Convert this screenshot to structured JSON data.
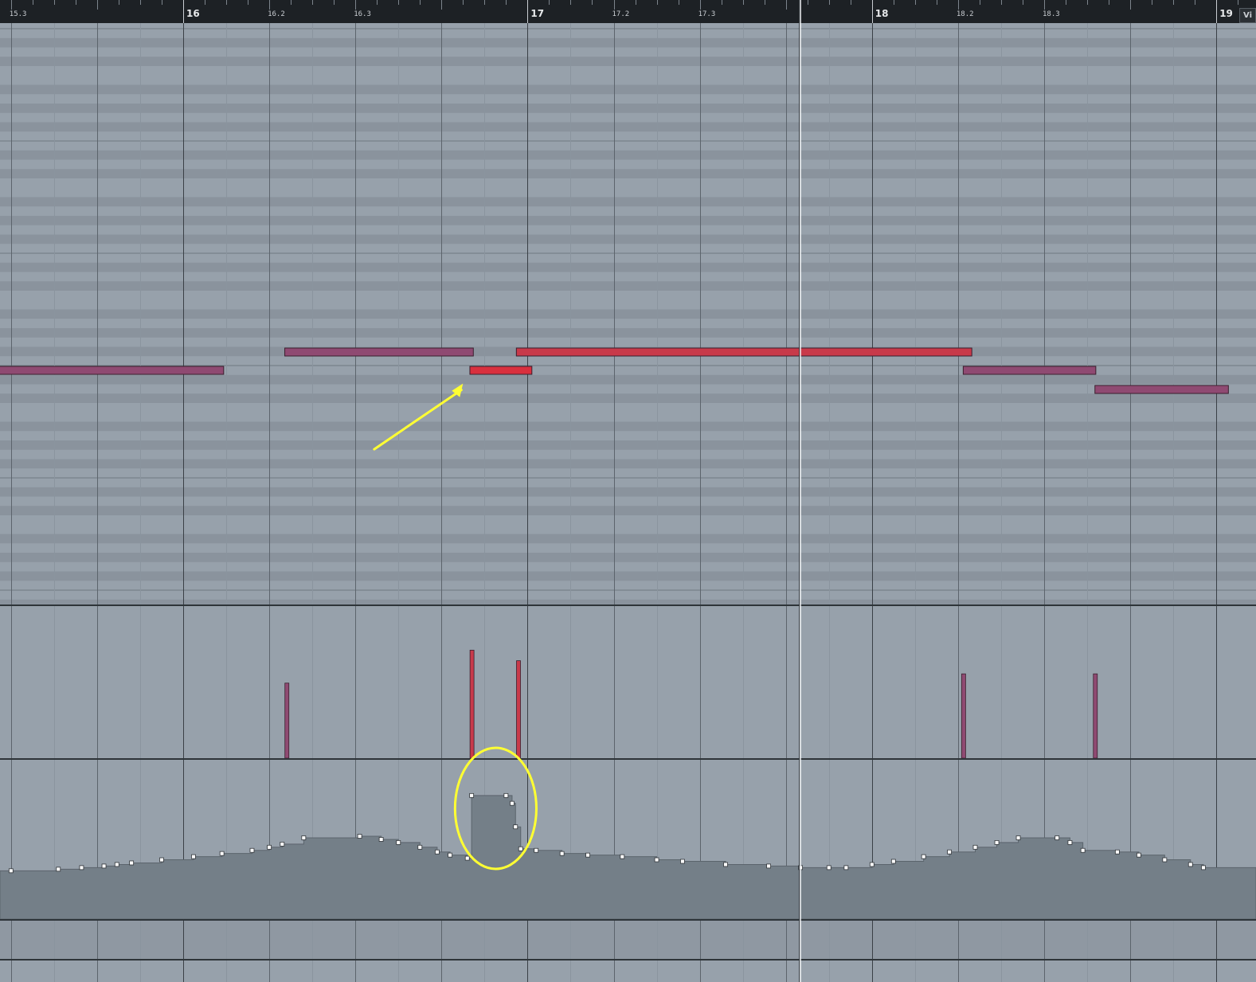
{
  "ruler": {
    "bars": [
      {
        "label": "16",
        "beat": 0
      },
      {
        "label": "17",
        "beat": 4
      },
      {
        "label": "18",
        "beat": 8
      },
      {
        "label": "19",
        "beat": 12
      }
    ],
    "beats": [
      {
        "label": "15.3",
        "beat": -2
      },
      {
        "label": "16.2",
        "beat": 1
      },
      {
        "label": "16.3",
        "beat": 2
      },
      {
        "label": "17.2",
        "beat": 5
      },
      {
        "label": "17.3",
        "beat": 6
      },
      {
        "label": "18.2",
        "beat": 9
      },
      {
        "label": "18.3",
        "beat": 10
      }
    ],
    "corner_button": "Vi"
  },
  "playhead_beat": 7.17,
  "colors": {
    "note_purple": "#8f4a72",
    "note_red": "#c83a4a",
    "note_red_selected": "#d9303e",
    "annotation": "#ffff33",
    "cc_fill": "#747f88",
    "lane_bg": "#97a1ab",
    "row_dark": "#8a939d"
  },
  "notes": [
    {
      "start": -2.2,
      "end": 0.47,
      "row": 1,
      "color": "purple"
    },
    {
      "start": 1.18,
      "end": 3.37,
      "row": 0,
      "color": "purple"
    },
    {
      "start": 3.33,
      "end": 4.05,
      "row": 1,
      "color": "red_selected"
    },
    {
      "start": 3.87,
      "end": 7.17,
      "row": 0,
      "color": "red"
    },
    {
      "start": 7.17,
      "end": 9.16,
      "row": 0,
      "color": "red"
    },
    {
      "start": 9.06,
      "end": 10.6,
      "row": 1,
      "color": "purple"
    },
    {
      "start": 10.59,
      "end": 12.14,
      "row": 2,
      "color": "purple"
    }
  ],
  "velocities": [
    {
      "beat": -2.16,
      "value": 53,
      "color": "purple"
    },
    {
      "beat": 1.2,
      "value": 57,
      "color": "purple"
    },
    {
      "beat": 3.35,
      "value": 82,
      "color": "red"
    },
    {
      "beat": 3.89,
      "value": 74,
      "color": "red"
    },
    {
      "beat": 9.06,
      "value": 64,
      "color": "purple"
    },
    {
      "beat": 10.59,
      "value": 64,
      "color": "purple"
    }
  ],
  "cc_points": [
    [
      -2.0,
      42
    ],
    [
      -1.45,
      43
    ],
    [
      -1.18,
      44
    ],
    [
      -0.92,
      45
    ],
    [
      -0.77,
      46
    ],
    [
      -0.6,
      47
    ],
    [
      -0.25,
      49
    ],
    [
      0.12,
      51
    ],
    [
      0.45,
      53
    ],
    [
      0.8,
      55
    ],
    [
      1.0,
      57
    ],
    [
      1.15,
      59
    ],
    [
      1.4,
      63
    ],
    [
      2.05,
      64
    ],
    [
      2.3,
      62
    ],
    [
      2.5,
      60
    ],
    [
      2.75,
      57
    ],
    [
      2.95,
      54
    ],
    [
      3.1,
      52
    ],
    [
      3.3,
      50
    ],
    [
      3.35,
      90
    ],
    [
      3.75,
      90
    ],
    [
      3.82,
      85
    ],
    [
      3.86,
      70
    ],
    [
      3.92,
      56
    ],
    [
      4.1,
      55
    ],
    [
      4.4,
      53
    ],
    [
      4.7,
      52
    ],
    [
      5.1,
      51
    ],
    [
      5.5,
      49
    ],
    [
      5.8,
      48
    ],
    [
      6.3,
      46
    ],
    [
      6.8,
      45
    ],
    [
      7.17,
      44
    ],
    [
      7.5,
      44
    ],
    [
      7.7,
      44
    ],
    [
      8.0,
      46
    ],
    [
      8.25,
      48
    ],
    [
      8.6,
      51
    ],
    [
      8.9,
      54
    ],
    [
      9.2,
      57
    ],
    [
      9.45,
      60
    ],
    [
      9.7,
      63
    ],
    [
      10.15,
      63
    ],
    [
      10.3,
      60
    ],
    [
      10.45,
      55
    ],
    [
      10.85,
      54
    ],
    [
      11.1,
      52
    ],
    [
      11.4,
      49
    ],
    [
      11.7,
      46
    ],
    [
      11.85,
      44
    ]
  ],
  "annotations": [
    {
      "type": "arrow",
      "from_beat": 2.2,
      "from_value": 0.733,
      "to_beat": 3.0,
      "to_value": 0.62
    },
    {
      "type": "circle",
      "center_beat": 3.63,
      "center_value": 75,
      "radius_beats": 0.35,
      "radius_value": 48
    }
  ]
}
